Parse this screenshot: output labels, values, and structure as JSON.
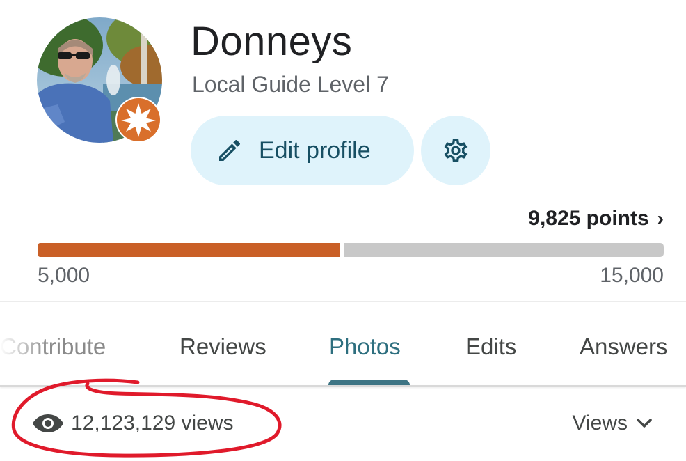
{
  "profile": {
    "name": "Donneys",
    "level": "Local Guide Level 7",
    "avatar_icon": "profile-photo",
    "badge_icon": "local-guide-star-badge"
  },
  "actions": {
    "edit_label": "Edit profile",
    "edit_icon": "pencil-icon",
    "settings_icon": "gear-icon"
  },
  "points": {
    "label": "9,825 points",
    "chevron": "›",
    "value": 9825,
    "min_label": "5,000",
    "max_label": "15,000",
    "min": 5000,
    "max": 15000
  },
  "tabs": [
    {
      "label": "Contribute"
    },
    {
      "label": "Reviews"
    },
    {
      "label": "Photos",
      "selected": true
    },
    {
      "label": "Edits"
    },
    {
      "label": "Answers"
    }
  ],
  "views": {
    "icon": "eye-icon",
    "count_label": "12,123,129 views",
    "sort_label": "Views",
    "sort_icon": "chevron-down-icon"
  },
  "colors": {
    "accent": "#c95f27",
    "track": "#c8c8c8",
    "button_bg": "#dff3fb",
    "button_text": "#174f63",
    "tab_selected": "#2e6f7f",
    "annotation": "#e01a2b"
  }
}
